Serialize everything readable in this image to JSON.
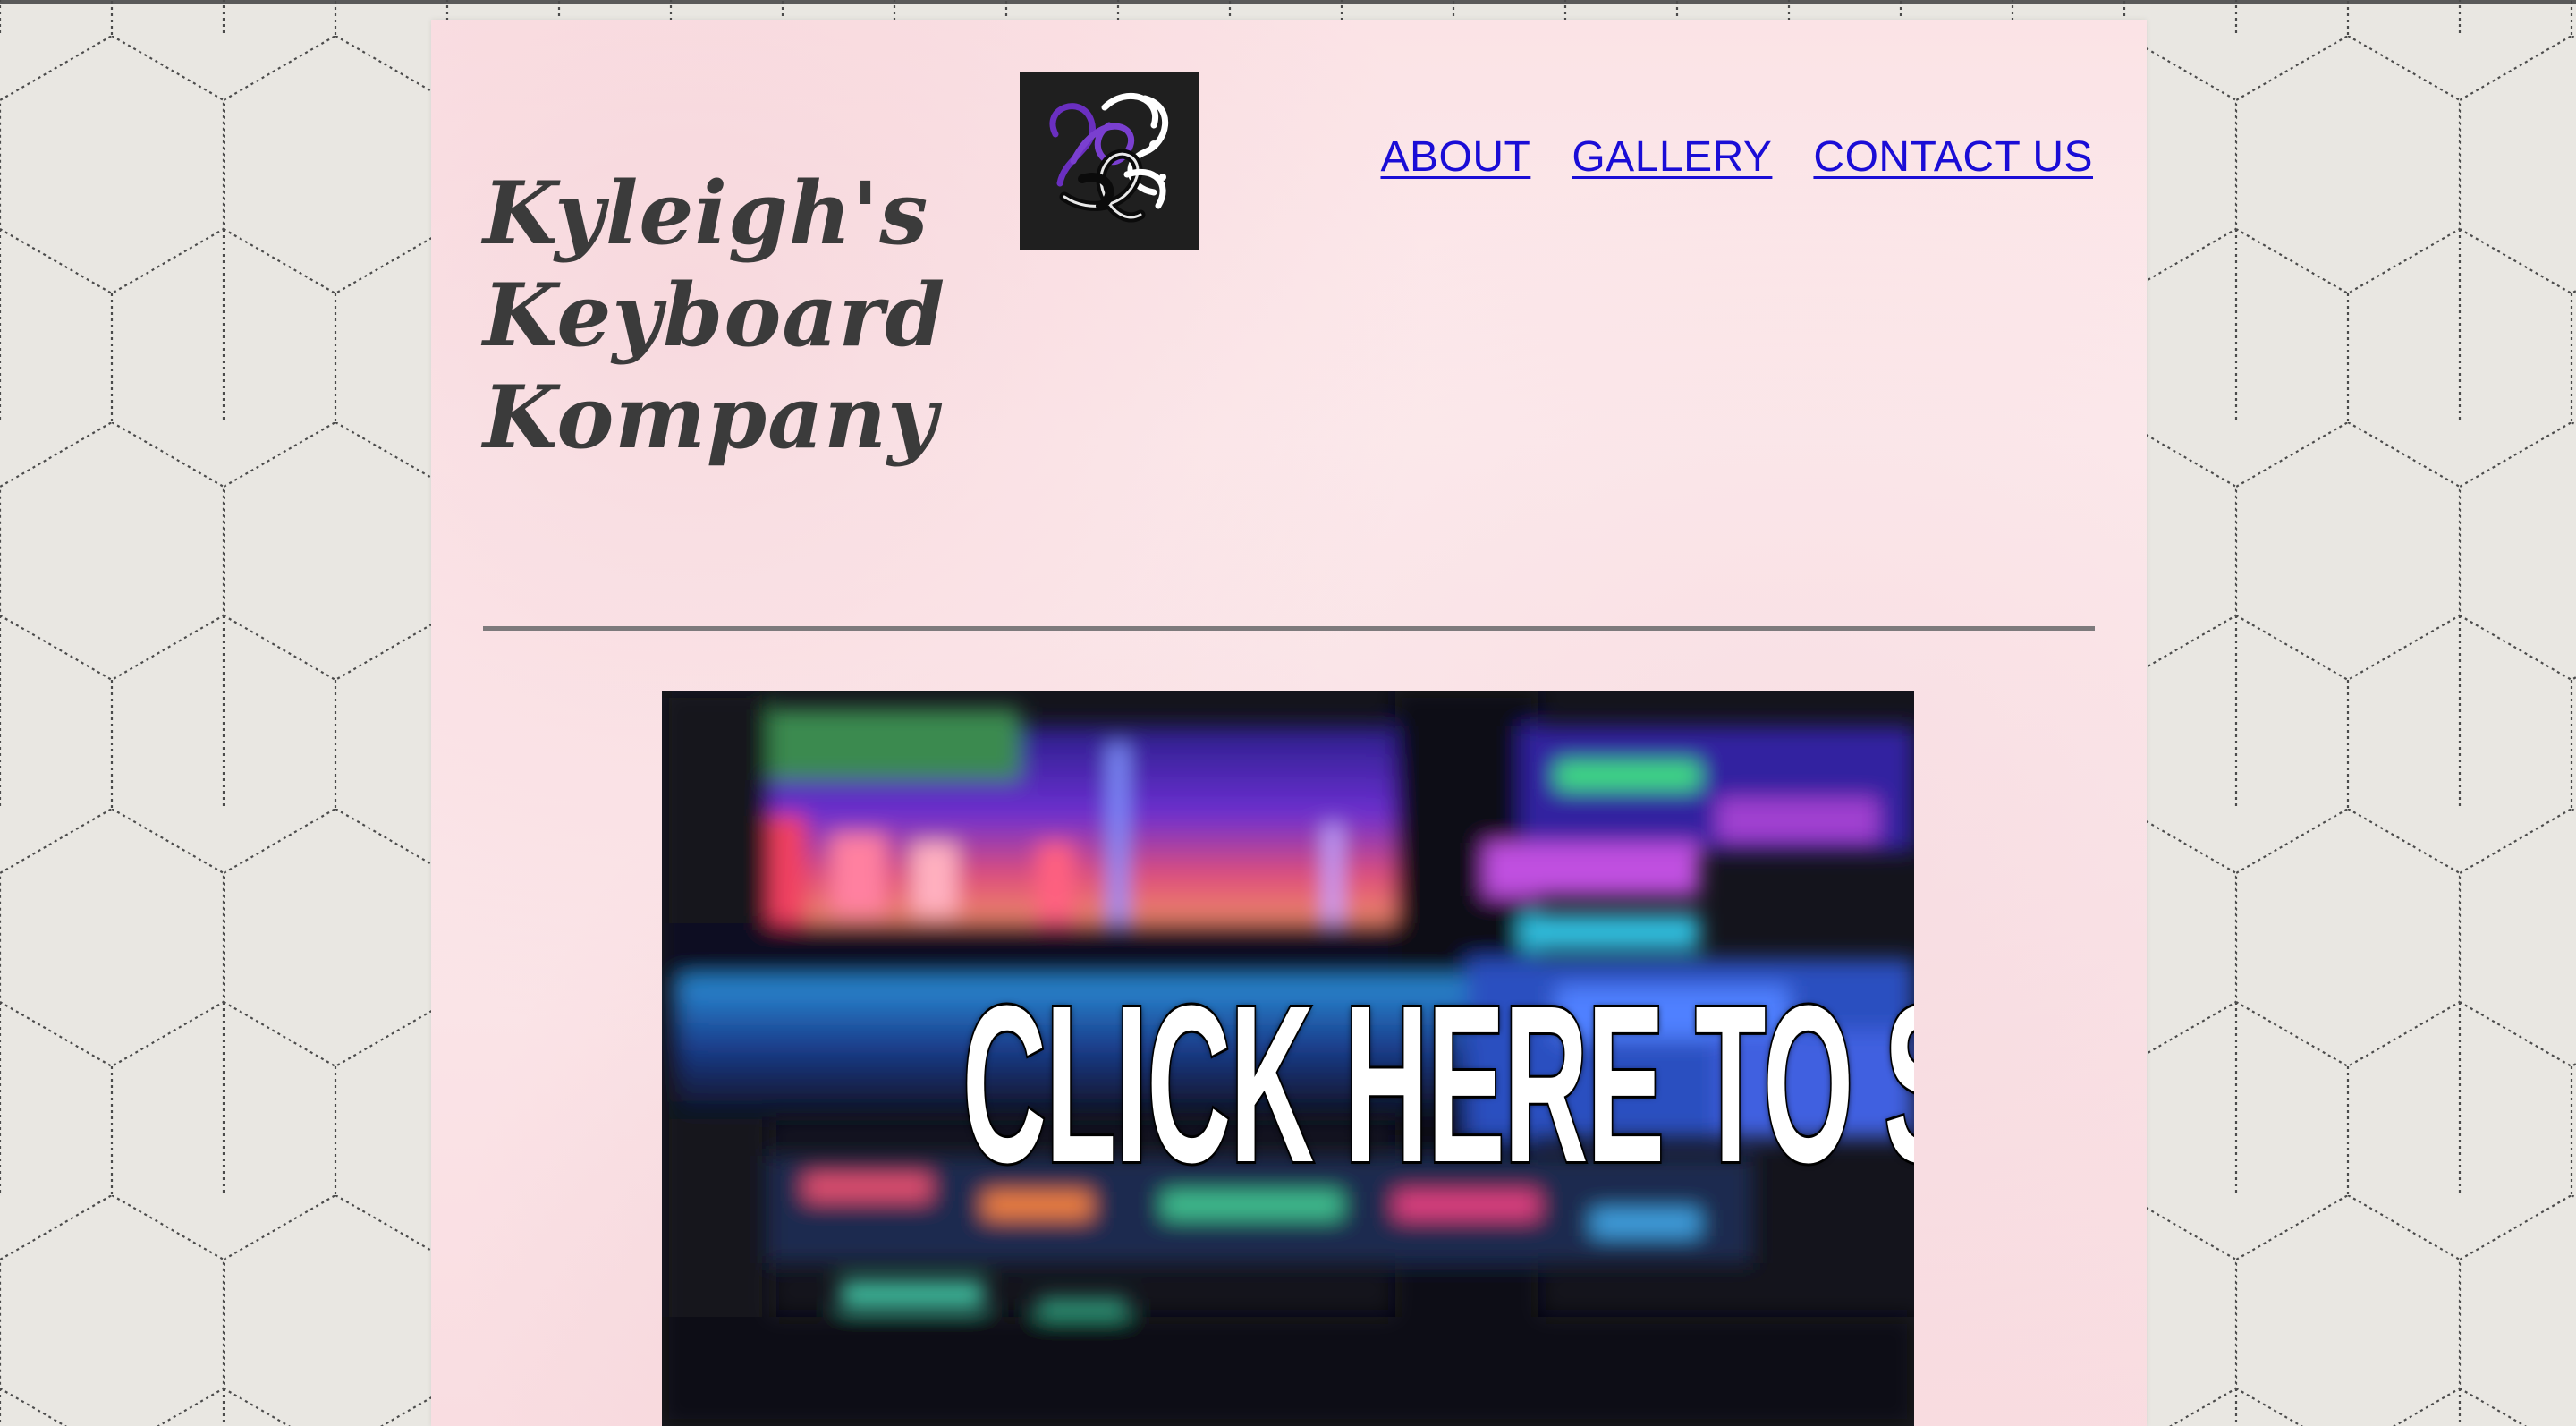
{
  "site": {
    "title_lines": [
      "Kyleigh's",
      "Keyboard",
      "Kompany"
    ]
  },
  "nav": {
    "items": [
      {
        "label": "ABOUT"
      },
      {
        "label": "GALLERY"
      },
      {
        "label": "CONTACT US"
      }
    ]
  },
  "hero": {
    "text": "CLICK HERE TO SHOP"
  },
  "colors": {
    "page_bg": "#e9e7e2",
    "panel_bg": "#fbe6e9",
    "title": "#3b3b3b",
    "nav_link": "#1a0dd6",
    "divider": "#7d7a7c",
    "logo_bg": "#1f1f1f",
    "logo_accent": "#6a2fc0"
  },
  "icons": {
    "logo": "knot-logo-icon",
    "background": "hexagon-pattern"
  }
}
